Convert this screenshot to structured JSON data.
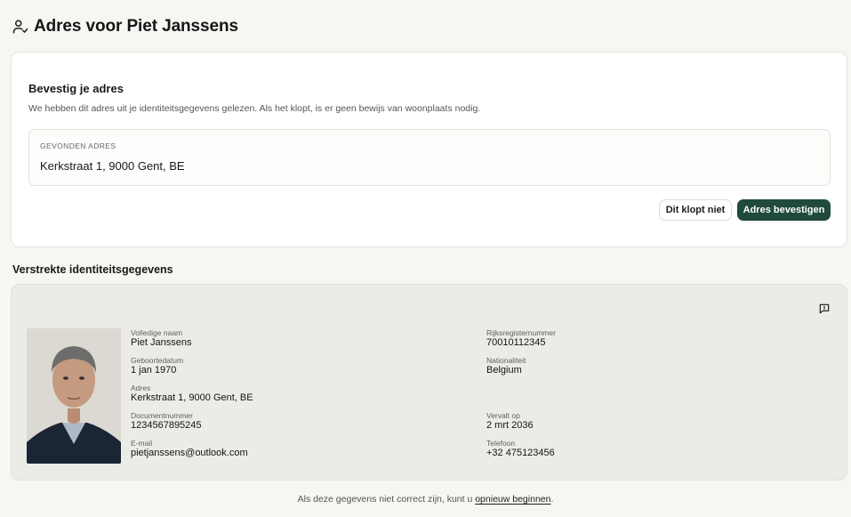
{
  "page": {
    "title": "Adres voor Piet Janssens"
  },
  "confirm": {
    "heading": "Bevestig je adres",
    "description": "We hebben dit adres uit je identiteitsgegevens gelezen. Als het klopt, is er geen bewijs van woonplaats nodig.",
    "found_label": "GEVONDEN ADRES",
    "found_value": "Kerkstraat 1, 9000 Gent, BE",
    "reject_label": "Dit klopt niet",
    "confirm_label": "Adres bevestigen"
  },
  "identity": {
    "section_title": "Verstrekte identiteitsgegevens",
    "full_name_label": "Volledige naam",
    "full_name": "Piet Janssens",
    "birthdate_label": "Geboortedatum",
    "birthdate": "1 jan 1970",
    "address_label": "Adres",
    "address": "Kerkstraat 1, 9000 Gent, BE",
    "document_number_label": "Documentnummer",
    "document_number": "1234567895245",
    "email_label": "E-mail",
    "email": "pietjanssens@outlook.com",
    "national_number_label": "Rijksregisternummer",
    "national_number": "70010112345",
    "nationality_label": "Nationaliteit",
    "nationality": "Belgium",
    "expires_label": "Vervalt op",
    "expires": "2 mrt 2036",
    "phone_label": "Telefoon",
    "phone": "+32 475123456"
  },
  "footer": {
    "text_before": "Als deze gegevens niet correct zijn, kunt u ",
    "link": "opnieuw beginnen",
    "text_after": "."
  },
  "icons": {
    "header": "user-check-icon",
    "feedback": "message-alert-icon"
  },
  "colors": {
    "primary": "#1f4a3c",
    "background": "#f6f6f3",
    "card": "#ffffff",
    "identity_card": "#ebebe8"
  }
}
